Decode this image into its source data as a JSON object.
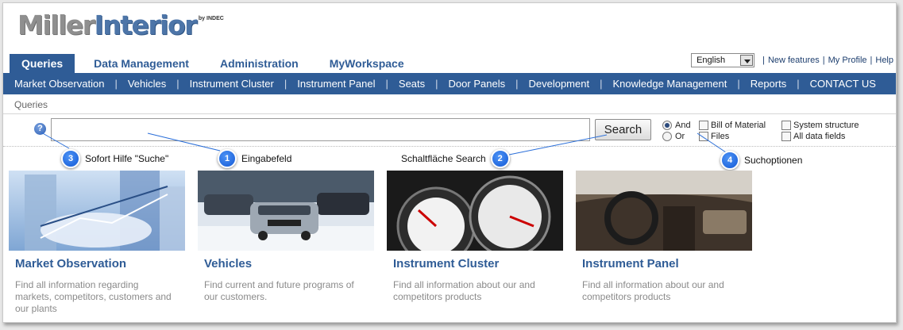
{
  "logo": {
    "part1": "Miller",
    "part2": "Interior",
    "suffix": "by INDEC"
  },
  "tabs": [
    {
      "label": "Queries",
      "active": true
    },
    {
      "label": "Data Management",
      "active": false
    },
    {
      "label": "Administration",
      "active": false
    },
    {
      "label": "MyWorkspace",
      "active": false
    }
  ],
  "utils": {
    "language": "English",
    "links": [
      "New features",
      "My Profile",
      "Help"
    ]
  },
  "subnav": [
    "Market Observation",
    "Vehicles",
    "Instrument Cluster",
    "Instrument Panel",
    "Seats",
    "Door Panels",
    "Development",
    "Knowledge Management",
    "Reports",
    "CONTACT US"
  ],
  "breadcrumb": "Queries",
  "search": {
    "input_value": "",
    "button_label": "Search",
    "help_glyph": "?",
    "radios": [
      {
        "label": "And",
        "checked": true
      },
      {
        "label": "Or",
        "checked": false
      }
    ],
    "checkboxes": [
      "Bill of Material",
      "Files",
      "System structure",
      "All data fields"
    ]
  },
  "callouts": [
    {
      "number": "3",
      "label": "Sofort Hilfe \"Suche\""
    },
    {
      "number": "1",
      "label": "Eingabefeld"
    },
    {
      "label": "Schaltfläche Search",
      "number": "2"
    },
    {
      "number": "4",
      "label": "Suchoptionen"
    }
  ],
  "cards": [
    {
      "title": "Market Observation",
      "desc": "Find all information regarding markets, competitors, customers and our plants"
    },
    {
      "title": "Vehicles",
      "desc": "Find current and future programs of our customers."
    },
    {
      "title": "Instrument Cluster",
      "desc": "Find all information about our and competitors products"
    },
    {
      "title": "Instrument Panel",
      "desc": "Find all information about our and competitors products"
    }
  ],
  "colors": {
    "brand_blue": "#2f5c96",
    "callout_blue": "#1359d6"
  }
}
